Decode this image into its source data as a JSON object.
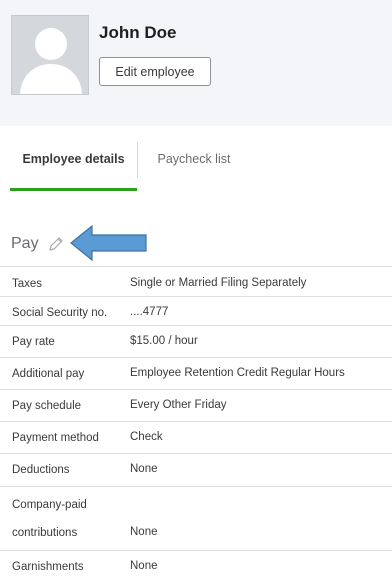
{
  "employee": {
    "name": "John Doe",
    "edit_label": "Edit employee"
  },
  "tabs": [
    {
      "label": "Employee details",
      "active": true
    },
    {
      "label": "Paycheck list",
      "active": false
    }
  ],
  "pay": {
    "heading": "Pay",
    "rows": [
      {
        "label": "Taxes",
        "value": "Single or Married Filing Separately"
      },
      {
        "label": "Social Security no.",
        "value": "....4777"
      },
      {
        "label": "Pay rate",
        "value": "$15.00 / hour"
      },
      {
        "label": "Additional pay",
        "value": "Employee Retention Credit Regular Hours"
      },
      {
        "label": "Pay schedule",
        "value": "Every Other Friday"
      },
      {
        "label": "Payment method",
        "value": "Check"
      },
      {
        "label": "Deductions",
        "value": "None"
      },
      {
        "label": "Company-paid",
        "label2": "contributions",
        "value": "None"
      },
      {
        "label": "Garnishments",
        "value": "None"
      }
    ]
  },
  "colors": {
    "accent_green": "#2ca01c",
    "arrow_blue": "#5b9bd5"
  },
  "icons": {
    "avatar": "person-silhouette-icon",
    "edit": "pencil-icon",
    "annotation": "left-arrow-icon"
  }
}
